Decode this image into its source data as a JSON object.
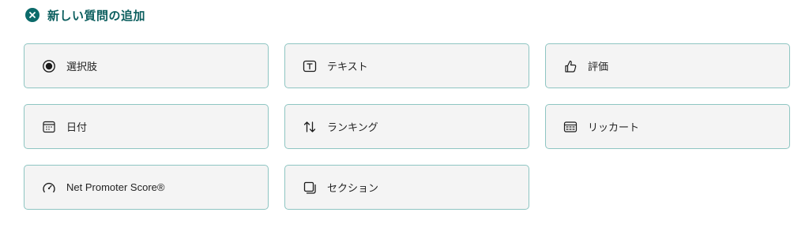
{
  "header": {
    "title": "新しい質問の追加",
    "icon": "close-circle-icon",
    "accent_color": "#0b6a6a"
  },
  "question_types": [
    {
      "id": "choice",
      "label": "選択肢",
      "icon": "radio-button-icon"
    },
    {
      "id": "text",
      "label": "テキスト",
      "icon": "text-box-icon"
    },
    {
      "id": "rating",
      "label": "評価",
      "icon": "thumbs-up-icon"
    },
    {
      "id": "date",
      "label": "日付",
      "icon": "calendar-icon"
    },
    {
      "id": "ranking",
      "label": "ランキング",
      "icon": "arrow-sort-icon"
    },
    {
      "id": "likert",
      "label": "リッカート",
      "icon": "likert-grid-icon"
    },
    {
      "id": "nps",
      "label": "Net Promoter Score®",
      "icon": "gauge-icon"
    },
    {
      "id": "section",
      "label": "セクション",
      "icon": "section-copy-icon"
    }
  ],
  "colors": {
    "card_border": "#8ec5c2",
    "card_background": "#f4f4f4",
    "icon_color": "#1b1b1b"
  }
}
